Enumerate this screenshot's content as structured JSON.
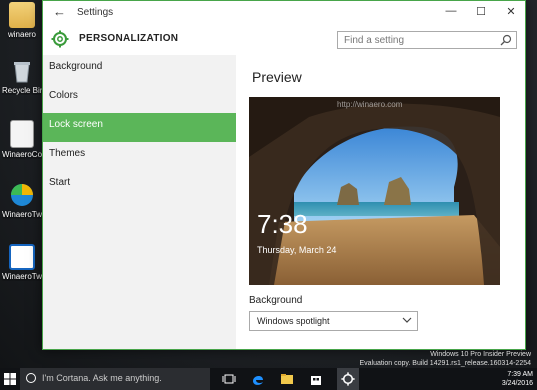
{
  "desktop": {
    "icons": [
      {
        "label": "winaero",
        "icon": "user-folder-icon"
      },
      {
        "label": "Recycle Bin",
        "icon": "recycle-bin-icon"
      },
      {
        "label": "WinaeroCo...",
        "icon": "document-icon"
      },
      {
        "label": "WinaeroTw...",
        "icon": "winaero-tweaker-icon"
      },
      {
        "label": "WinaeroTw...",
        "icon": "window-app-icon"
      }
    ]
  },
  "window": {
    "title": "Settings",
    "back_icon": "back-arrow-icon",
    "controls": {
      "minimize": "—",
      "maximize": "☐",
      "close": "✕"
    },
    "header": {
      "title": "PERSONALIZATION",
      "search_placeholder": "Find a setting"
    },
    "sidebar": {
      "items": [
        {
          "label": "Background",
          "active": false
        },
        {
          "label": "Colors",
          "active": false
        },
        {
          "label": "Lock screen",
          "active": true
        },
        {
          "label": "Themes",
          "active": false
        },
        {
          "label": "Start",
          "active": false
        }
      ]
    },
    "content": {
      "title": "Preview",
      "preview_time": "7:38",
      "preview_date": "Thursday, March 24",
      "preview_watermark": "http://winaero.com",
      "background_label": "Background",
      "background_value": "Windows spotlight"
    }
  },
  "taskbar": {
    "search_text": "I'm Cortana. Ask me anything.",
    "clock_time": "7:39 AM",
    "clock_date": "3/24/2016",
    "watermark_line1": "Windows 10 Pro Insider Preview",
    "watermark_line2": "Evaluation copy. Build 14291.rs1_release.160314-2254"
  },
  "colors": {
    "accent": "#5bb659"
  }
}
